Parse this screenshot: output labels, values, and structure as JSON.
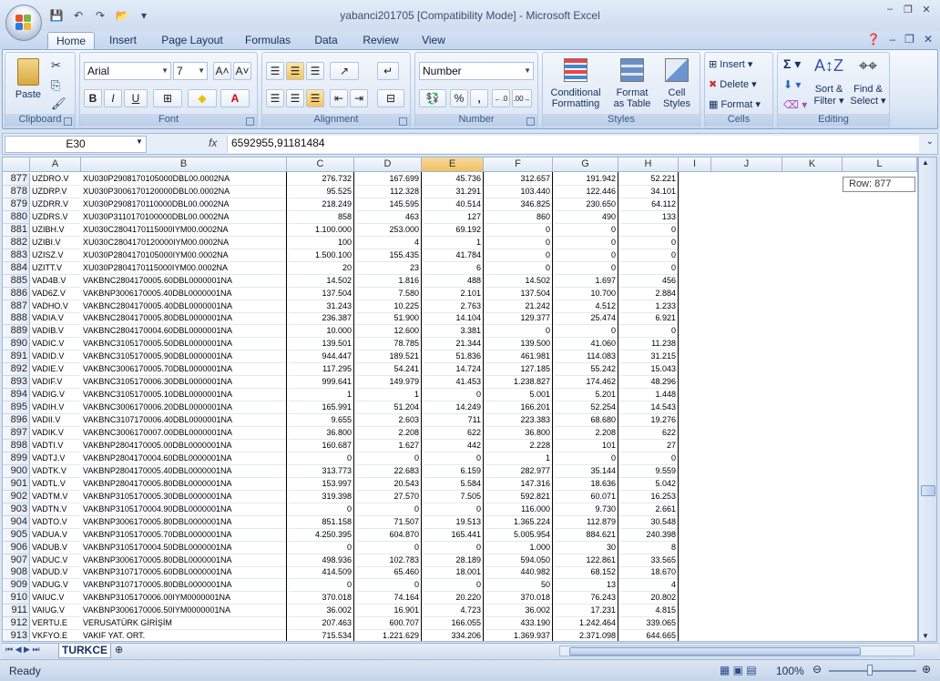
{
  "window": {
    "title": "yabanci201705  [Compatibility Mode] - Microsoft Excel",
    "min": "–",
    "max": "❐",
    "close": "✕"
  },
  "ribbon_tabs": [
    "Home",
    "Insert",
    "Page Layout",
    "Formulas",
    "Data",
    "Review",
    "View"
  ],
  "ribbon": {
    "clipboard": {
      "label": "Clipboard",
      "paste": "Paste"
    },
    "font": {
      "label": "Font",
      "name": "Arial",
      "size": "7"
    },
    "alignment": {
      "label": "Alignment"
    },
    "number": {
      "label": "Number",
      "format": "Number",
      "percent": "%",
      "comma": ","
    },
    "styles": {
      "label": "Styles",
      "conditional": "Conditional",
      "conditional2": "Formatting",
      "format_table": "Format",
      "format_table2": "as Table",
      "cell_styles": "Cell",
      "cell_styles2": "Styles"
    },
    "cells": {
      "label": "Cells",
      "insert": "Insert",
      "delete": "Delete",
      "format": "Format"
    },
    "editing": {
      "label": "Editing",
      "sort": "Sort &",
      "sort2": "Filter",
      "find": "Find &",
      "find2": "Select"
    }
  },
  "formula_bar": {
    "name_box": "E30",
    "fx": "fx",
    "value": "6592955,91181484"
  },
  "columns": [
    "A",
    "B",
    "C",
    "D",
    "E",
    "F",
    "G",
    "H",
    "I",
    "J",
    "K",
    "L"
  ],
  "tooltip": "Row: 877",
  "rows": [
    [
      "877",
      "UZDRO.V",
      "XU030P2908170105000DBL00.0002NA",
      "276.732",
      "167.699",
      "45.736",
      "312.657",
      "191.942",
      "52.221"
    ],
    [
      "878",
      "UZDRP.V",
      "XU030P3006170120000DBL00.0002NA",
      "95.525",
      "112.328",
      "31.291",
      "103.440",
      "122.446",
      "34.101"
    ],
    [
      "879",
      "UZDRR.V",
      "XU030P2908170110000DBL00.0002NA",
      "218.249",
      "145.595",
      "40.514",
      "346.825",
      "230.650",
      "64.112"
    ],
    [
      "880",
      "UZDRS.V",
      "XU030P3110170100000DBL00.0002NA",
      "858",
      "463",
      "127",
      "860",
      "490",
      "133"
    ],
    [
      "881",
      "UZIBH.V",
      "XU030C2804170115000IYM00.0002NA",
      "1.100.000",
      "253.000",
      "69.192",
      "0",
      "0",
      "0"
    ],
    [
      "882",
      "UZIBI.V",
      "XU030C2804170120000IYM00.0002NA",
      "100",
      "4",
      "1",
      "0",
      "0",
      "0"
    ],
    [
      "883",
      "UZISZ.V",
      "XU030P2804170105000IYM00.0002NA",
      "1.500.100",
      "155.435",
      "41.784",
      "0",
      "0",
      "0"
    ],
    [
      "884",
      "UZITT.V",
      "XU030P2804170115000IYM00.0002NA",
      "20",
      "23",
      "6",
      "0",
      "0",
      "0"
    ],
    [
      "885",
      "VAD4B.V",
      "VAKBNC2804170005.60DBL0000001NA",
      "14.502",
      "1.816",
      "488",
      "14.502",
      "1.697",
      "456"
    ],
    [
      "886",
      "VAD6Z.V",
      "VAKBNP3006170005.40DBL0000001NA",
      "137.504",
      "7.580",
      "2.101",
      "137.504",
      "10.700",
      "2.884"
    ],
    [
      "887",
      "VADHO.V",
      "VAKBNC2804170005.40DBL0000001NA",
      "31.243",
      "10.225",
      "2.763",
      "21.242",
      "4.512",
      "1.233"
    ],
    [
      "888",
      "VADIA.V",
      "VAKBNC2804170005.80DBL0000001NA",
      "236.387",
      "51.900",
      "14.104",
      "129.377",
      "25.474",
      "6.921"
    ],
    [
      "889",
      "VADIB.V",
      "VAKBNC2804170004.60DBL0000001NA",
      "10.000",
      "12.600",
      "3.381",
      "0",
      "0",
      "0"
    ],
    [
      "890",
      "VADIC.V",
      "VAKBNC3105170005.50DBL0000001NA",
      "139.501",
      "78.785",
      "21.344",
      "139.500",
      "41.060",
      "11.238"
    ],
    [
      "891",
      "VADID.V",
      "VAKBNC3105170005.90DBL0000001NA",
      "944.447",
      "189.521",
      "51.836",
      "461.981",
      "114.083",
      "31.215"
    ],
    [
      "892",
      "VADIE.V",
      "VAKBNC3006170005.70DBL0000001NA",
      "117.295",
      "54.241",
      "14.724",
      "127.185",
      "55.242",
      "15.043"
    ],
    [
      "893",
      "VADIF.V",
      "VAKBNC3105170006.30DBL0000001NA",
      "999.641",
      "149.979",
      "41.453",
      "1.238.827",
      "174.462",
      "48.296"
    ],
    [
      "894",
      "VADIG.V",
      "VAKBNC3105170005.10DBL0000001NA",
      "1",
      "1",
      "0",
      "5.001",
      "5.201",
      "1.448"
    ],
    [
      "895",
      "VADIH.V",
      "VAKBNC3006170006.20DBL0000001NA",
      "165.991",
      "51.204",
      "14.249",
      "166.201",
      "52.254",
      "14.543"
    ],
    [
      "896",
      "VADII.V",
      "VAKBNC3107170006.40DBL0000001NA",
      "9.655",
      "2.603",
      "711",
      "223.383",
      "68.680",
      "19.276"
    ],
    [
      "897",
      "VADIK.V",
      "VAKBNC3006170007.00DBL0000001NA",
      "36.800",
      "2.208",
      "622",
      "36.800",
      "2.208",
      "622"
    ],
    [
      "898",
      "VADTI.V",
      "VAKBNP2804170005.00DBL0000001NA",
      "160.687",
      "1.627",
      "442",
      "2.228",
      "101",
      "27"
    ],
    [
      "899",
      "VADTJ.V",
      "VAKBNP2804170004.60DBL0000001NA",
      "0",
      "0",
      "0",
      "1",
      "0",
      "0"
    ],
    [
      "900",
      "VADTK.V",
      "VAKBNP2804170005.40DBL0000001NA",
      "313.773",
      "22.683",
      "6.159",
      "282.977",
      "35.144",
      "9.559"
    ],
    [
      "901",
      "VADTL.V",
      "VAKBNP2804170005.80DBL0000001NA",
      "153.997",
      "20.543",
      "5.584",
      "147.316",
      "18.636",
      "5.042"
    ],
    [
      "902",
      "VADTM.V",
      "VAKBNP3105170005.30DBL0000001NA",
      "319.398",
      "27.570",
      "7.505",
      "592.821",
      "60.071",
      "16.253"
    ],
    [
      "903",
      "VADTN.V",
      "VAKBNP3105170004.90DBL0000001NA",
      "0",
      "0",
      "0",
      "116.000",
      "9.730",
      "2.661"
    ],
    [
      "904",
      "VADTO.V",
      "VAKBNP3006170005.80DBL0000001NA",
      "851.158",
      "71.507",
      "19.513",
      "1.365.224",
      "112.879",
      "30.548"
    ],
    [
      "905",
      "VADUA.V",
      "VAKBNP3105170005.70DBL0000001NA",
      "4.250.395",
      "604.870",
      "165.441",
      "5.005.954",
      "884.621",
      "240.398"
    ],
    [
      "906",
      "VADUB.V",
      "VAKBNP3105170004.50DBL0000001NA",
      "0",
      "0",
      "0",
      "1.000",
      "30",
      "8"
    ],
    [
      "907",
      "VADUC.V",
      "VAKBNP3006170005.80DBL0000001NA",
      "498.936",
      "102.783",
      "28.189",
      "594.050",
      "122.861",
      "33.565"
    ],
    [
      "908",
      "VADUD.V",
      "VAKBNP3107170005.60DBL0000001NA",
      "414.509",
      "65.460",
      "18.001",
      "440.982",
      "68.152",
      "18.670"
    ],
    [
      "909",
      "VADUG.V",
      "VAKBNP3107170005.80DBL0000001NA",
      "0",
      "0",
      "0",
      "50",
      "13",
      "4"
    ],
    [
      "910",
      "VAIUC.V",
      "VAKBNP3105170006.00IYM0000001NA",
      "370.018",
      "74.164",
      "20.220",
      "370.018",
      "76.243",
      "20.802"
    ],
    [
      "911",
      "VAIUG.V",
      "VAKBNP3006170006.50IYM0000001NA",
      "36.002",
      "16.901",
      "4.723",
      "36.002",
      "17.231",
      "4.815"
    ],
    [
      "912",
      "VERTU.E",
      "VERUSATÜRK GİRİŞİM",
      "207.463",
      "600.707",
      "166.055",
      "433.190",
      "1.242.464",
      "339.065"
    ],
    [
      "913",
      "VKFYO.E",
      "VAKIF YAT. ORT.",
      "715.534",
      "1.221.629",
      "334.206",
      "1.369.937",
      "2.371.098",
      "644.665"
    ]
  ],
  "sheet_tab": "TURKCE",
  "status": {
    "ready": "Ready",
    "zoom": "100%"
  }
}
